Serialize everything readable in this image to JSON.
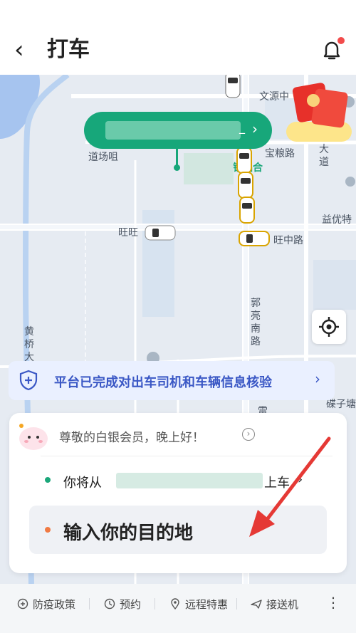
{
  "header": {
    "back_symbol": "‹",
    "title": "打车"
  },
  "map": {
    "labels": {
      "wenyuan": "文源中",
      "baoliang_road": "宝粮路",
      "da_dao": "大道",
      "daochang": "道场咀",
      "gangluhe": "钢铝合",
      "yiyou": "益优特",
      "wangwang": "旺旺",
      "wangzhong_road": "旺中路",
      "guoliang_road": "郭亮南路",
      "huangqiao": "黄桥大",
      "xiaozitang": "碟子塘",
      "lei": "雷"
    },
    "bubble_mark": "_"
  },
  "notice": {
    "text": "平台已完成对出车司机和车辆信息核验"
  },
  "card": {
    "greeting": "尊敬的白银会员，晚上好！",
    "start_prefix": "你将从",
    "start_suffix": "上车",
    "destination_placeholder": "输入你的目的地"
  },
  "bottom_bar": {
    "items": [
      {
        "label": "防疫政策",
        "icon": "shield-plus-icon"
      },
      {
        "label": "预约",
        "icon": "clock-icon"
      },
      {
        "label": "远程特惠",
        "icon": "location-icon"
      },
      {
        "label": "接送机",
        "icon": "plane-icon"
      }
    ]
  },
  "colors": {
    "brand_green": "#17a77a",
    "notice_blue": "#3a57c5",
    "dest_orange": "#f07a43",
    "badge_red": "#f24b4b"
  }
}
